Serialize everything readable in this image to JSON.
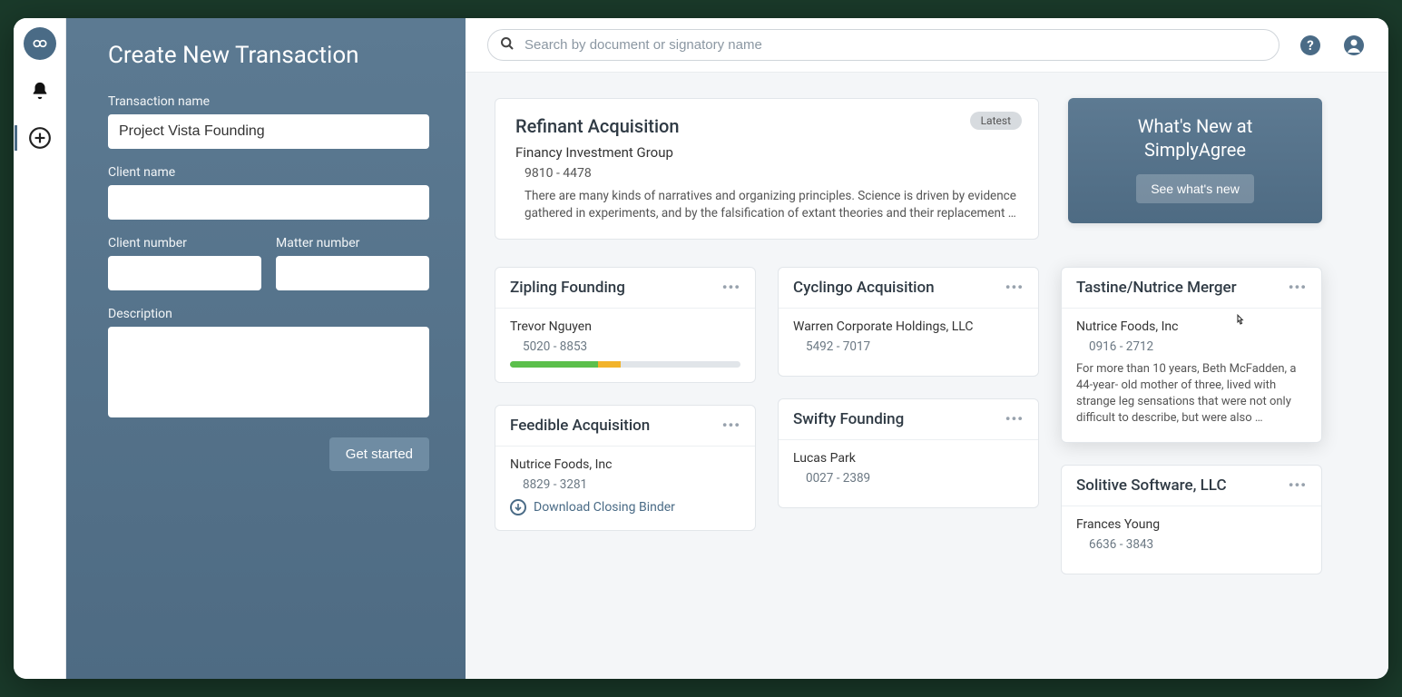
{
  "sidebar": {
    "title": "Create New Transaction",
    "labels": {
      "transaction_name": "Transaction name",
      "client_name": "Client name",
      "client_number": "Client number",
      "matter_number": "Matter number",
      "description": "Description"
    },
    "values": {
      "transaction_name": "Project Vista Founding",
      "client_name": "",
      "client_number": "",
      "matter_number": "",
      "description": ""
    },
    "get_started": "Get started"
  },
  "search": {
    "placeholder": "Search by document or signatory name"
  },
  "whats_new": {
    "title_line1": "What's New at",
    "title_line2": "SimplyAgree",
    "button": "See what's new"
  },
  "hero": {
    "title": "Refinant Acquisition",
    "client": "Financy Investment Group",
    "numbers": "9810 - 4478",
    "description": "There are many kinds of narratives and organizing principles. Science is driven by evidence gathered in experiments, and by the falsification of extant theories and their replacement …",
    "badge": "Latest"
  },
  "cards": {
    "zipling": {
      "title": "Zipling Founding",
      "client": "Trevor Nguyen",
      "numbers": "5020 - 8853",
      "progress_green_pct": 38,
      "progress_yellow_pct": 10
    },
    "feedible": {
      "title": "Feedible Acquisition",
      "client": "Nutrice Foods, Inc",
      "numbers": "8829 - 3281",
      "download_label": "Download Closing Binder"
    },
    "cyclingo": {
      "title": "Cyclingo Acquisition",
      "client": "Warren Corporate Holdings, LLC",
      "numbers": "5492 - 7017"
    },
    "swifty": {
      "title": "Swifty Founding",
      "client": "Lucas Park",
      "numbers": "0027 - 2389"
    },
    "tastine": {
      "title": "Tastine/Nutrice Merger",
      "client": "Nutrice Foods, Inc",
      "numbers": "0916 - 2712",
      "description": "For more than 10 years, Beth McFadden, a 44-year- old mother of three, lived with strange leg sensations that were not only difficult to describe, but were also …"
    },
    "solitive": {
      "title": "Solitive Software, LLC",
      "client": "Frances Young",
      "numbers": "6636 - 3843"
    }
  }
}
